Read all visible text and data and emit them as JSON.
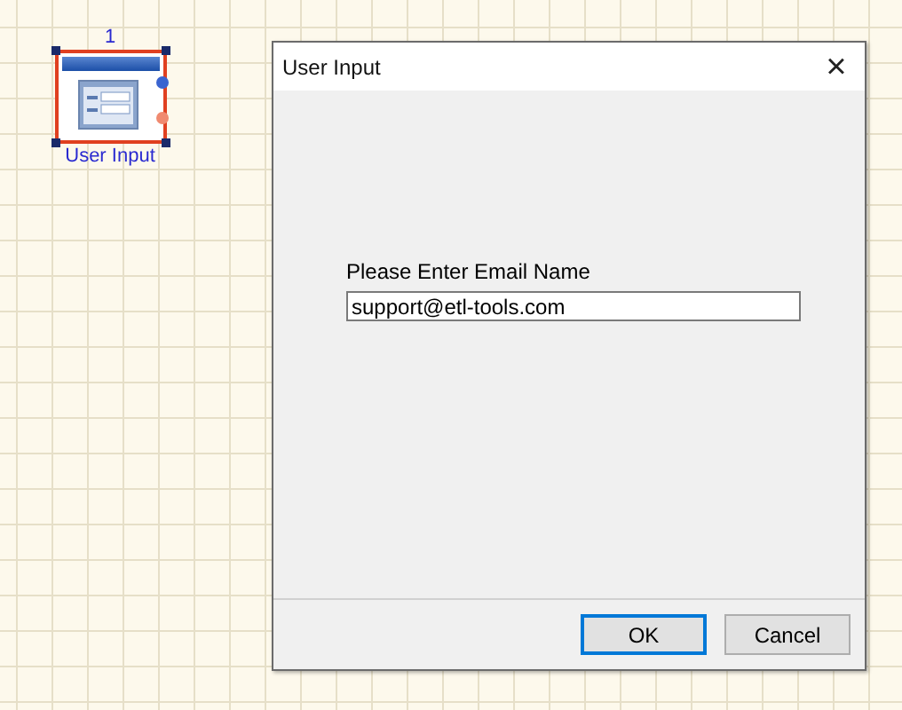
{
  "canvas": {
    "nodes": [
      {
        "number": "1",
        "label": "User Input",
        "selected": true
      }
    ]
  },
  "dialog": {
    "title": "User Input",
    "close": "×",
    "prompt": "Please Enter Email Name",
    "value": "support@etl-tools.com",
    "buttons": [
      {
        "label": "OK",
        "default": true
      },
      {
        "label": "Cancel",
        "default": false
      }
    ]
  }
}
